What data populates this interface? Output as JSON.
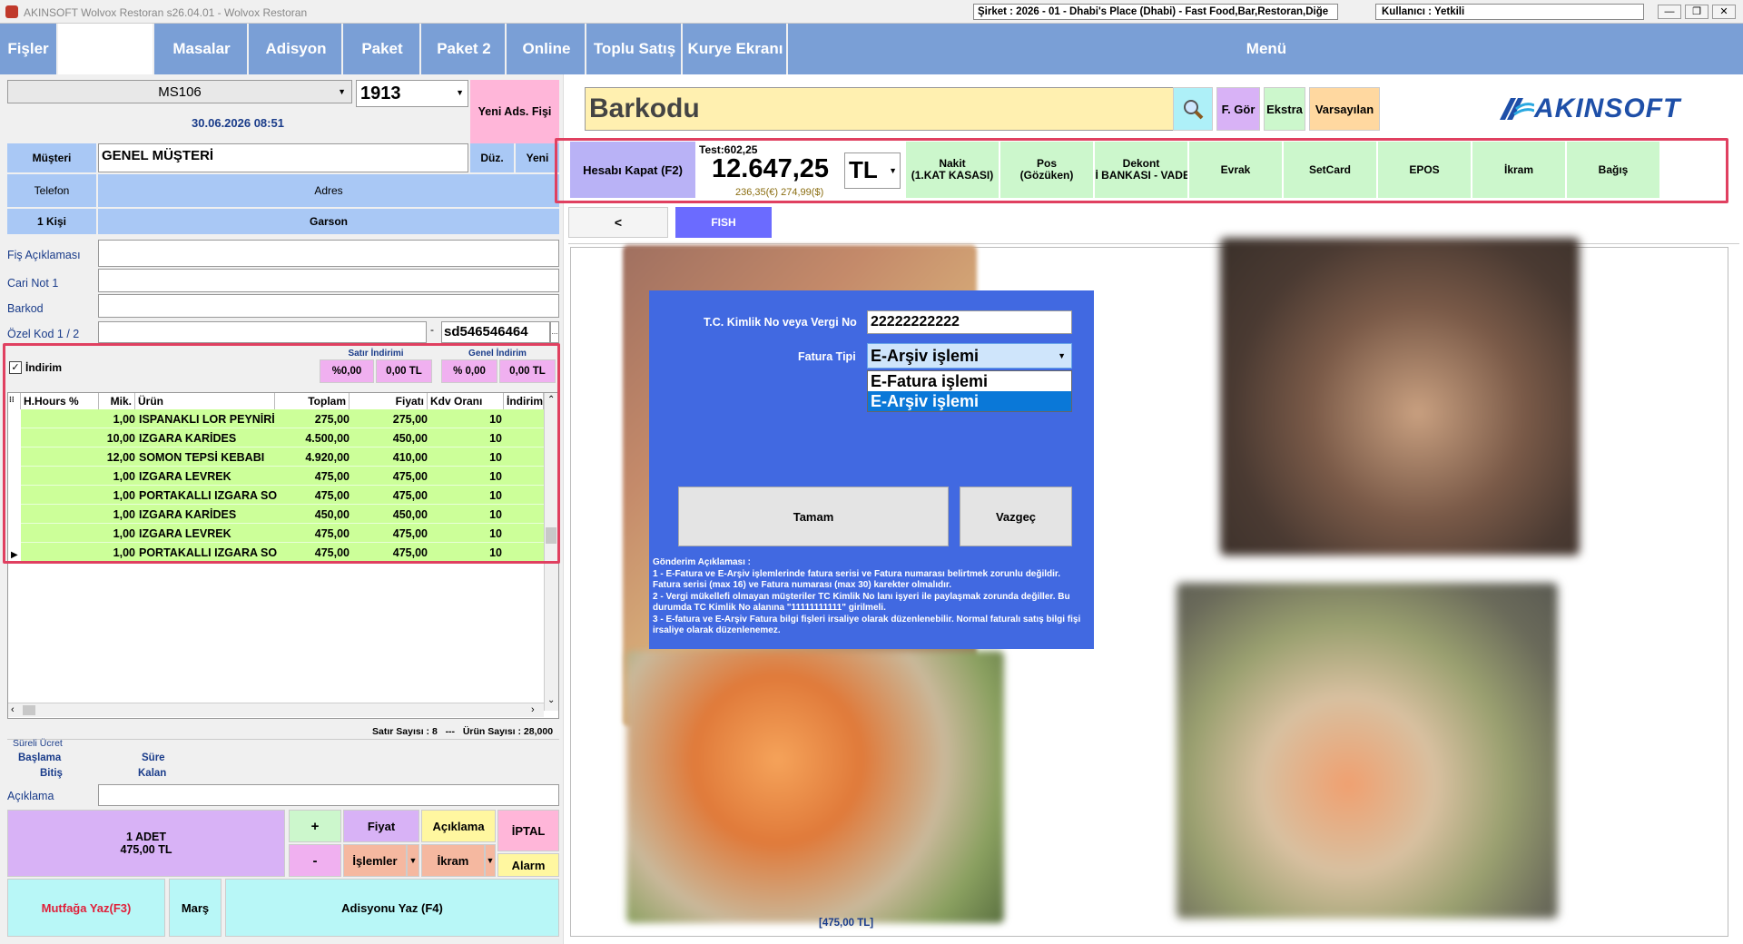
{
  "window": {
    "title": "AKINSOFT Wolvox Restoran s26.04.01 - Wolvox Restoran",
    "company": "Şirket : 2026 - 01 - Dhabi's Place (Dhabi) - Fast Food,Bar,Restoran,Diğe",
    "user": "Kullanıcı : Yetkili",
    "controls": [
      "—",
      "❐",
      "✕"
    ]
  },
  "nav": {
    "fisler": "Fişler",
    "masalar": "Masalar",
    "adisyon": "Adisyon",
    "paket": "Paket",
    "paket2": "Paket 2",
    "online": "Online",
    "toplu_satis": "Toplu Satış",
    "kurye": "Kurye Ekranı",
    "menu": "Menü"
  },
  "order": {
    "table": "MS106",
    "number": "1913",
    "datetime": "30.06.2026 08:51",
    "new_slip": "Yeni Ads. Fişi",
    "customer_label": "Müşteri",
    "customer": "GENEL MÜŞTERİ",
    "edit_btn": "Düz.",
    "new_btn": "Yeni",
    "phone_label": "Telefon",
    "address_label": "Adres",
    "persons": "1 Kişi",
    "waiter_label": "Garson",
    "note_label": "Fiş Açıklaması",
    "cari_note_label": "Cari Not 1",
    "barcode_label": "Barkod",
    "special_code_label": "Özel Kod 1 / 2",
    "special_code_dash": "-",
    "special_code_value": "sd546546464",
    "special_code_btn": "..."
  },
  "discount": {
    "label": "İndirim",
    "row_title": "Satır İndirimi",
    "general_title": "Genel İndirim",
    "row_pct": "%0,00",
    "row_tl": "0,00 TL",
    "gen_pct": "% 0,00",
    "gen_tl": "0,00 TL"
  },
  "grid": {
    "columns": [
      "H.Hours %",
      "Mik.",
      "Ürün",
      "Toplam",
      "Fiyatı",
      "Kdv Oranı",
      "İndirim"
    ],
    "rows": [
      {
        "qty": "1,00",
        "name": "ISPANAKLI LOR PEYNİRİ",
        "total": "275,00",
        "price": "275,00",
        "vat": "10"
      },
      {
        "qty": "10,00",
        "name": "IZGARA KARİDES",
        "total": "4.500,00",
        "price": "450,00",
        "vat": "10"
      },
      {
        "qty": "12,00",
        "name": "SOMON TEPSİ KEBABI",
        "total": "4.920,00",
        "price": "410,00",
        "vat": "10"
      },
      {
        "qty": "1,00",
        "name": "IZGARA LEVREK",
        "total": "475,00",
        "price": "475,00",
        "vat": "10"
      },
      {
        "qty": "1,00",
        "name": "PORTAKALLI IZGARA SO",
        "total": "475,00",
        "price": "475,00",
        "vat": "10"
      },
      {
        "qty": "1,00",
        "name": "IZGARA KARİDES",
        "total": "450,00",
        "price": "450,00",
        "vat": "10"
      },
      {
        "qty": "1,00",
        "name": "IZGARA LEVREK",
        "total": "475,00",
        "price": "475,00",
        "vat": "10"
      },
      {
        "qty": "1,00",
        "name": "PORTAKALLI IZGARA SO",
        "total": "475,00",
        "price": "475,00",
        "vat": "10"
      }
    ],
    "row_count": "Satır Sayısı : 8",
    "sep": "---",
    "product_count": "Ürün Sayısı : 28,000"
  },
  "timed": {
    "title": "Süreli Ücret",
    "start": "Başlama",
    "end": "Bitiş",
    "duration": "Süre",
    "remaining": "Kalan",
    "desc_label": "Açıklama"
  },
  "actions": {
    "summary_qty": "1 ADET",
    "summary_price": "475,00 TL",
    "plus": "+",
    "minus": "-",
    "price": "Fiyat",
    "desc": "Açıklama",
    "cancel": "İPTAL",
    "operations": "İşlemler",
    "treat": "İkram",
    "alarm": "Alarm",
    "kitchen": "Mutfağa Yaz(F3)",
    "mars": "Marş",
    "write_bill": "Adisyonu Yaz (F4)",
    "dd": "▼"
  },
  "topright": {
    "barcode_placeholder": "Barkodu",
    "f_gor": "F. Gör",
    "ekstra": "Ekstra",
    "varsayilan": "Varsayılan",
    "logo": "AKINSOFT"
  },
  "payment": {
    "close": "Hesabı Kapat (F2)",
    "test": "Test:602,25",
    "total": "12.647,25",
    "currency": "TL",
    "fx": "236,35(€) 274,99($)",
    "methods": [
      {
        "l1": "Nakit",
        "l2": "(1.KAT KASASI)"
      },
      {
        "l1": "Pos",
        "l2": "(Gözüken)"
      },
      {
        "l1": "Dekont",
        "l2": "İ BANKASI - VADE"
      },
      {
        "l1": "Evrak",
        "l2": ""
      },
      {
        "l1": "SetCard",
        "l2": ""
      },
      {
        "l1": "EPOS",
        "l2": ""
      },
      {
        "l1": "İkram",
        "l2": ""
      },
      {
        "l1": "Bağış",
        "l2": ""
      }
    ]
  },
  "menu": {
    "back": "<",
    "category": "FISH",
    "price_tag": "[475,00 TL]"
  },
  "dialog": {
    "tc_label": "T.C. Kimlik No veya Vergi No",
    "tc_value": "22222222222",
    "type_label": "Fatura Tipi",
    "type_value": "E-Arşiv işlemi",
    "options": [
      "E-Fatura işlemi",
      "E-Arşiv işlemi"
    ],
    "ok": "Tamam",
    "cancel": "Vazgeç",
    "note_title": "Gönderim Açıklaması :",
    "note_1": "1 - E-Fatura ve E-Arşiv  işlemlerinde fatura serisi ve Fatura numarası belirtmek zorunlu değildir. Fatura serisi (max 16) ve Fatura numarası (max 30) karekter olmalıdır.",
    "note_2": "2 - Vergi mükellefi olmayan müşteriler TC Kimlik No lanı işyeri ile paylaşmak zorunda değiller. Bu durumda TC Kimlik No alanına \"11111111111\" girilmeli.",
    "note_3": "3 - E-fatura ve E-Arşiv Fatura bilgi fişleri irsaliye olarak düzenlenebilir. Normal faturalı satış bilgi fişi irsaliye olarak düzenlenemez."
  },
  "colors": {
    "nav": "#7a9fd6",
    "label_blue": "#a9c8f5",
    "row_green": "#ccff99",
    "pay_green": "#ccf7cc",
    "dialog_blue": "#4169e1",
    "highlight_red": "#e04060"
  }
}
